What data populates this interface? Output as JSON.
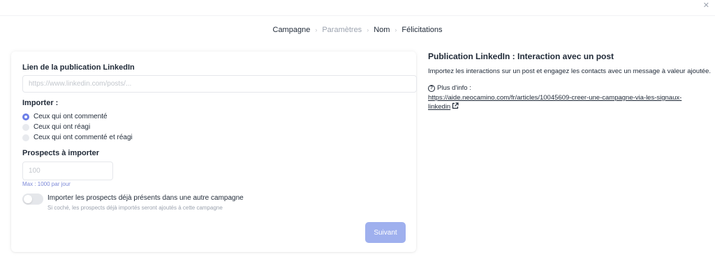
{
  "window": {
    "close_icon": "close-icon"
  },
  "steps": [
    {
      "label": "Campagne",
      "state": "done"
    },
    {
      "label": "Paramètres",
      "state": "current"
    },
    {
      "label": "Nom",
      "state": "todo"
    },
    {
      "label": "Félicitations",
      "state": "todo"
    }
  ],
  "form": {
    "url_label": "Lien de la publication LinkedIn",
    "url_placeholder": "https://www.linkedin.com/posts/...",
    "url_value": "",
    "import_label": "Importer :",
    "import_options": [
      {
        "label": "Ceux qui ont commenté",
        "checked": true
      },
      {
        "label": "Ceux qui ont réagi",
        "checked": false
      },
      {
        "label": "Ceux qui ont commenté et réagi",
        "checked": false
      }
    ],
    "prospects_label": "Prospects à importer",
    "prospects_placeholder": "100",
    "prospects_value": "",
    "prospects_hint": "Max : 1000 par jour",
    "toggle_label": "Importer les prospects déjà présents dans une autre campagne",
    "toggle_hint": "Si coché, les prospects déjà importés seront ajoutés à cette campagne",
    "toggle_on": false,
    "next_button": "Suivant"
  },
  "info": {
    "title": "Publication LinkedIn : Interaction avec un post",
    "description": "Importez les interactions sur un post et engagez les contacts avec un message à valeur ajoutée.",
    "more_label": "Plus d'info :",
    "link_text": "https://aide.neocamino.com/fr/articles/10045609-creer-une-campagne-via-les-signaux-linkedin"
  },
  "colors": {
    "accent": "#6d7fe8",
    "button_disabled": "#9fb0ee",
    "hint_blue": "#7d8ad8"
  }
}
